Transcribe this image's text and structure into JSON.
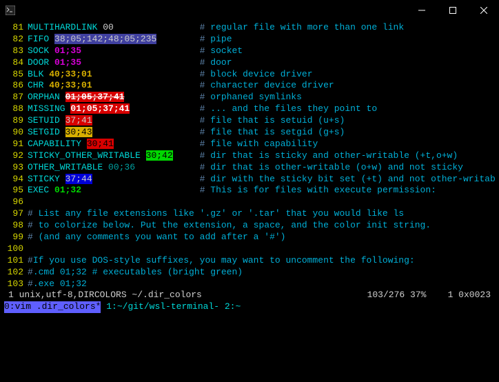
{
  "titlebar": {
    "icon": "terminal-icon"
  },
  "lines": [
    {
      "n": "81",
      "key": "MULTIHARDLINK",
      "code": "00",
      "codeClass": "white",
      "comment": "regular file with more than one link"
    },
    {
      "n": "82",
      "key": "FIFO",
      "code": "38;05;142;48;05;235",
      "codeClass": "grey-on-blue",
      "comment": "pipe"
    },
    {
      "n": "83",
      "key": "SOCK",
      "code": "01;35",
      "codeClass": "purple",
      "comment": "socket"
    },
    {
      "n": "84",
      "key": "DOOR",
      "code": "01;35",
      "codeClass": "purple",
      "comment": "door"
    },
    {
      "n": "85",
      "key": "BLK",
      "code": "40;33;01",
      "codeClass": "yellow-on-black",
      "comment": "block device driver"
    },
    {
      "n": "86",
      "key": "CHR",
      "code": "40;33;01",
      "codeClass": "yellow-on-black",
      "comment": "character device driver"
    },
    {
      "n": "87",
      "key": "ORPHAN",
      "code": "01;05;37;41",
      "codeClass": "orphan-code",
      "comment": "orphaned symlinks"
    },
    {
      "n": "88",
      "key": "MISSING",
      "code": "01;05;37;41",
      "codeClass": "missing-code",
      "comment": "... and the files they point to"
    },
    {
      "n": "89",
      "key": "SETUID",
      "code": "37;41",
      "codeClass": "setuid-code",
      "comment": "file that is setuid (u+s)"
    },
    {
      "n": "90",
      "key": "SETGID",
      "code": "30;43",
      "codeClass": "setgid-code",
      "comment": "file that is setgid (g+s)"
    },
    {
      "n": "91",
      "key": "CAPABILITY",
      "code": "30;41",
      "codeClass": "cap-code",
      "comment": "file with capability"
    },
    {
      "n": "92",
      "key": "STICKY_OTHER_WRITABLE",
      "code": "30;42",
      "codeClass": "sow-code",
      "comment": "dir that is sticky and other-writable (+t,o+w)"
    },
    {
      "n": "93",
      "key": "OTHER_WRITABLE",
      "code": "00;36",
      "codeClass": "ow-code",
      "comment": "dir that is other-writable (o+w) and not sticky"
    },
    {
      "n": "94",
      "key": "STICKY",
      "code": "37;44",
      "codeClass": "sticky-code",
      "comment": "dir with the sticky bit set (+t) and not other-writable"
    },
    {
      "n": "95",
      "key": "EXEC",
      "code": "01;32",
      "codeClass": "exec-code",
      "comment": "This is for files with execute permission:"
    }
  ],
  "blank96": "96",
  "comments": [
    {
      "n": "97",
      "text": "List any file extensions like '.gz' or '.tar' that you would like ls"
    },
    {
      "n": "98",
      "text": "to colorize below. Put the extension, a space, and the color init string."
    },
    {
      "n": "99",
      "text": "(and any comments you want to add after a '#')"
    }
  ],
  "blank100": "100",
  "comments2": [
    {
      "n": "101",
      "text": "If you use DOS-style suffixes, you may want to uncomment the following:"
    },
    {
      "n": "102",
      "text": ".cmd 01;32 # executables (bright green)"
    },
    {
      "n": "103",
      "text": ".exe 01;32"
    }
  ],
  "status": {
    "left": "1 unix,utf-8,DIRCOLORS ~/.dir_colors",
    "right": "103/276 37%    1 0x0023"
  },
  "tmux": {
    "active": "0:vim .dir_colors*",
    "win1": " 1:~/git/wsl-terminal-",
    "win2": " 2:~"
  },
  "comment_col": 32
}
